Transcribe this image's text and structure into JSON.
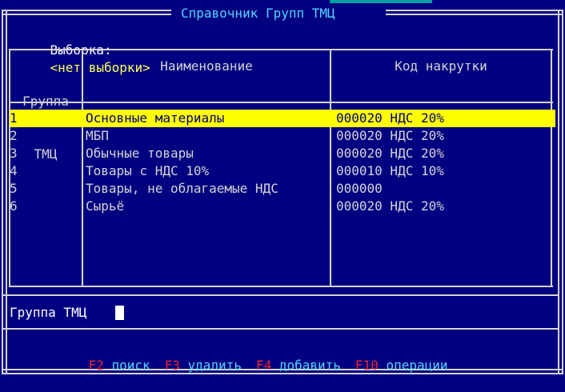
{
  "window": {
    "title": "Справочник Групп ТМЦ"
  },
  "selection": {
    "label": "Выборка:",
    "value": "<нет выборки>"
  },
  "columns": {
    "group_line1": "Группа",
    "group_line2": "ТМЦ",
    "name": "Наименование",
    "markup_code": "Код накрутки"
  },
  "rows": [
    {
      "group": "1",
      "name": "Основные материалы",
      "code": "000020 НДС 20%"
    },
    {
      "group": "2",
      "name": "МБП",
      "code": "000020 НДС 20%"
    },
    {
      "group": "3",
      "name": "Обычные товары",
      "code": "000020 НДС 20%"
    },
    {
      "group": "4",
      "name": "Товары с НДС 10%",
      "code": "000010 НДС 10%"
    },
    {
      "group": "5",
      "name": "Товары, не облагаемые НДС",
      "code": "000000"
    },
    {
      "group": "6",
      "name": "Сырьё",
      "code": "000020 НДС 20%"
    }
  ],
  "input": {
    "label": "Группа ТМЦ"
  },
  "function_keys": [
    {
      "key": "F2",
      "label": "поиск"
    },
    {
      "key": "F3",
      "label": "удалить"
    },
    {
      "key": "F4",
      "label": "добавить"
    },
    {
      "key": "F10",
      "label": "операции"
    }
  ],
  "colors": {
    "background": "#000080",
    "frame": "#d4d4d4",
    "title": "#55d4ff",
    "highlight": "#ffff00",
    "selection_value": "#ffff55",
    "function_key": "#e8272c"
  }
}
